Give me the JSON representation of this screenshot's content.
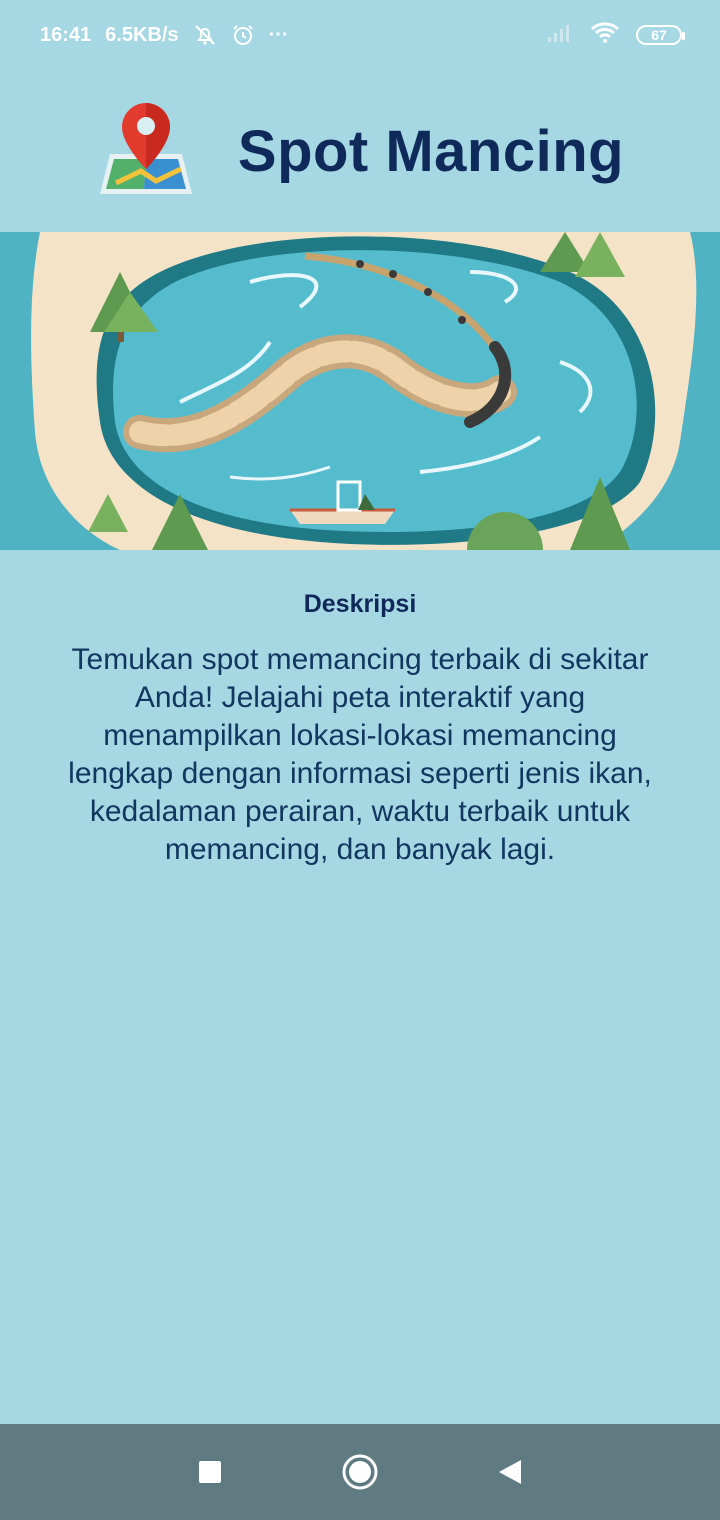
{
  "status_bar": {
    "time": "16:41",
    "net_speed": "6.5KB/s",
    "icons": [
      "notification-muted-icon",
      "alarm-icon",
      "more-dots-icon",
      "signal-icon",
      "wifi-icon",
      "battery-icon"
    ],
    "more": "···",
    "battery_level": "67"
  },
  "header": {
    "title": "Spot Mancing",
    "logo_icon": "map-pin-icon"
  },
  "hero": {
    "illustration": "fishing-lake-illustration"
  },
  "description": {
    "heading": "Deskripsi",
    "body": "Temukan spot memancing terbaik di sekitar Anda! Jelajahi peta interaktif yang menampilkan lokasi-lokasi memancing lengkap dengan informasi seperti jenis ikan, kedalaman perairan, waktu terbaik untuk memancing, dan banyak lagi."
  },
  "nav_bar": {
    "buttons": [
      "recent-apps-button",
      "home-button",
      "back-button"
    ]
  },
  "colors": {
    "background": "#a6d8e4",
    "title": "#0f2a5a",
    "nav_bar": "#5f7a80",
    "water": "#4fb8c9",
    "sand": "#f5e3c8"
  }
}
